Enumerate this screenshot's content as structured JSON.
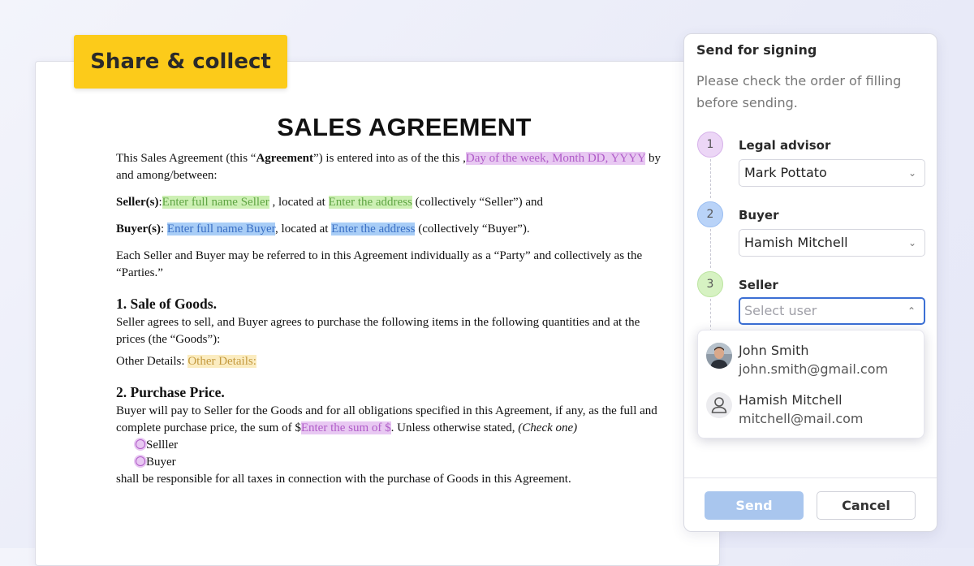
{
  "badge": {
    "label": "Share & collect"
  },
  "document": {
    "title": "SALES AGREEMENT",
    "intro": {
      "before": "This Sales Agreement (this “",
      "bold": "Agreement",
      "after": "”) is entered into as of the this ,",
      "date_field": "Day of the week, Month DD, YYYY",
      "end": " by and among/between:"
    },
    "seller_line": {
      "label": "Seller(s)",
      "colon": ":",
      "name_field": "Enter full name Seller",
      "located": " , located at ",
      "address_field": "Enter the address",
      "end": " (collectively “Seller”) and"
    },
    "buyer_line": {
      "label": "Buyer(s)",
      "colon": ": ",
      "name_field": "Enter full name Buyer",
      "located": ", located at ",
      "address_field": "Enter the address",
      "end": " (collectively “Buyer”)."
    },
    "parties_paragraph": "Each Seller and Buyer may be referred to in this Agreement individually as a “Party” and collectively as the “Parties.”",
    "section1": {
      "heading": "1. Sale of Goods.",
      "body": "Seller agrees to sell, and Buyer agrees to purchase the following items in the following quantities and at the prices (the “Goods”):",
      "other_label": "Other Details: ",
      "other_field": "Other Details:"
    },
    "section2": {
      "heading": "2. Purchase Price.",
      "body_before": "Buyer will pay to Seller for the Goods and for all obligations specified in this Agreement, if any, as the full and complete purchase price, the sum of $",
      "sum_field": "Enter the sum of $",
      "body_after": ". Unless otherwise stated, ",
      "check_one": "(Check one)",
      "options": [
        "Selller",
        "Buyer"
      ],
      "closing": "shall be responsible for all taxes in connection with the purchase of Goods in this Agreement."
    }
  },
  "panel": {
    "title": "Send for signing",
    "subtitle": "Please check the order of filling before sending.",
    "steps": [
      {
        "number": "1",
        "role": "Legal advisor",
        "value": "Mark Pottato",
        "color": "#ecd6f6",
        "border": "#d7b3ea"
      },
      {
        "number": "2",
        "role": "Buyer",
        "value": "Hamish Mitchell",
        "color": "#b9d3f8",
        "border": "#9cbff2"
      },
      {
        "number": "3",
        "role": "Seller",
        "placeholder": "Select user",
        "color": "#d6f2c2",
        "border": "#bde5a2"
      }
    ],
    "dropdown": [
      {
        "name": "John Smith",
        "email": "john.smith@gmail.com",
        "avatar": "photo"
      },
      {
        "name": "Hamish Mitchell",
        "email": "mitchell@mail.com",
        "avatar": "person-icon"
      }
    ],
    "send_label": "Send",
    "cancel_label": "Cancel"
  }
}
